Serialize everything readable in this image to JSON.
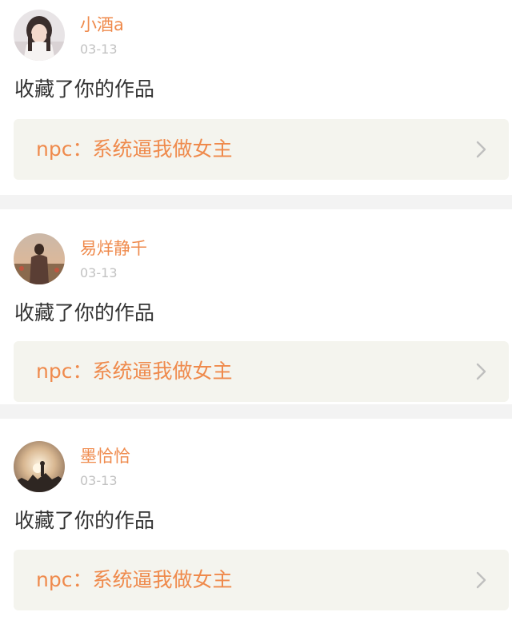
{
  "notifications": [
    {
      "username": "小酒a",
      "date": "03-13",
      "action": "收藏了你的作品",
      "work_title": "npc：系统逼我做女主",
      "avatar_icon": "avatar-girl-photo"
    },
    {
      "username": "易烊静千",
      "date": "03-13",
      "action": "收藏了你的作品",
      "work_title": "npc：系统逼我做女主",
      "avatar_icon": "avatar-sunset-person-photo"
    },
    {
      "username": "墨恰恰",
      "date": "03-13",
      "action": "收藏了你的作品",
      "work_title": "npc：系统逼我做女主",
      "avatar_icon": "avatar-sunset-silhouette-photo"
    }
  ],
  "colors": {
    "accent": "#ef8a4c",
    "date": "#c2c2c2",
    "text": "#333333",
    "card_bg": "#f4f4ee",
    "separator": "#f3f3f3"
  }
}
